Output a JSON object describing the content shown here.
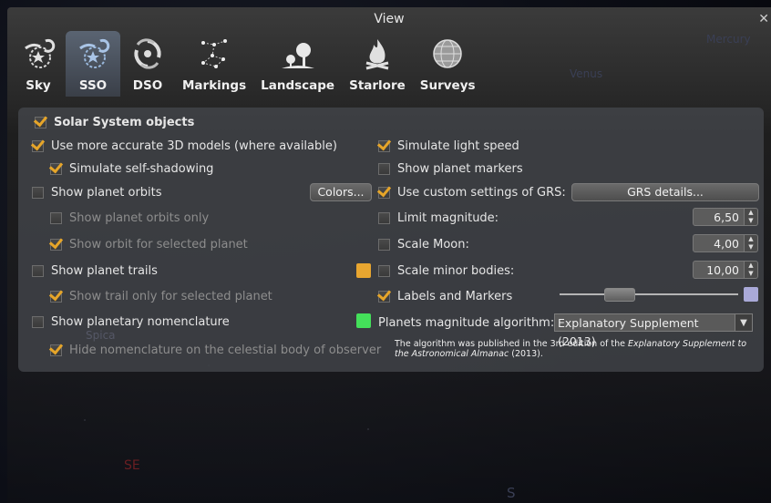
{
  "window": {
    "title": "View",
    "close": "✕"
  },
  "tabs": [
    {
      "label": "Sky",
      "icon": "sky-icon",
      "active": false
    },
    {
      "label": "SSO",
      "icon": "sso-icon",
      "active": true
    },
    {
      "label": "DSO",
      "icon": "galaxy-icon",
      "active": false
    },
    {
      "label": "Markings",
      "icon": "constellation-icon",
      "active": false
    },
    {
      "label": "Landscape",
      "icon": "landscape-icon",
      "active": false
    },
    {
      "label": "Starlore",
      "icon": "flame-icon",
      "active": false
    },
    {
      "label": "Surveys",
      "icon": "sphere-icon",
      "active": false
    }
  ],
  "left": {
    "solar_system": "Solar System objects",
    "accurate_models": "Use more accurate 3D models (where available)",
    "self_shadowing": "Simulate self-shadowing",
    "planet_orbits": "Show planet orbits",
    "colors_button": "Colors...",
    "orbits_only": "Show planet orbits only",
    "orbit_selected": "Show orbit for selected planet",
    "planet_trails": "Show planet trails",
    "trail_selected": "Show trail only for selected planet",
    "nomenclature": "Show planetary nomenclature",
    "hide_nomenclature": "Hide nomenclature on the celestial body of observer"
  },
  "right": {
    "light_speed": "Simulate light speed",
    "planet_markers": "Show planet markers",
    "grs": "Use custom settings of GRS:",
    "grs_button": "GRS details...",
    "limit_magnitude": "Limit magnitude:",
    "limit_magnitude_value": "6,50",
    "scale_moon": "Scale Moon:",
    "scale_moon_value": "4,00",
    "scale_minor": "Scale minor bodies:",
    "scale_minor_value": "10,00",
    "labels_markers": "Labels and Markers",
    "labels_markers_level": 0.3,
    "magnitude_algorithm": "Planets magnitude algorithm:",
    "magnitude_algorithm_value": "Explanatory Supplement (2013)",
    "note_1": "The algorithm was published in the 3rd edition of the ",
    "note_book": "Explanatory Supplement to the Astronomical Almanac",
    "note_2": " (2013)."
  },
  "sky_labels": {
    "mercury": "Mercury",
    "venus": "Venus",
    "spica": "Spica",
    "se": "SE",
    "s": "S"
  },
  "colors": {
    "accent": "#e6a529",
    "trail_swatch": "#e8a630",
    "nomenclature_swatch": "#44e05a",
    "labels_swatch": "#a9a9d8"
  }
}
